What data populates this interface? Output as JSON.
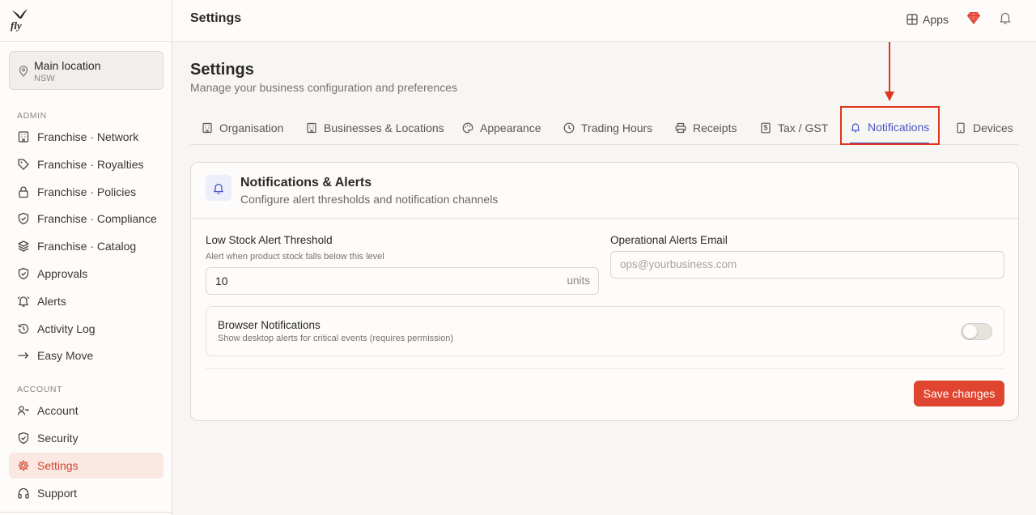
{
  "app": {
    "logo_text": "fly"
  },
  "sidebar": {
    "location": {
      "name": "Main location",
      "sub": "NSW"
    },
    "admin_label": "ADMIN",
    "admin_items": [
      {
        "label": "Franchise · Network",
        "icon": "building-icon"
      },
      {
        "label": "Franchise · Royalties",
        "icon": "tag-icon"
      },
      {
        "label": "Franchise · Policies",
        "icon": "lock-icon"
      },
      {
        "label": "Franchise · Compliance",
        "icon": "shield-check-icon"
      },
      {
        "label": "Franchise · Catalog",
        "icon": "layers-icon"
      },
      {
        "label": "Approvals",
        "icon": "shield-check-icon"
      },
      {
        "label": "Alerts",
        "icon": "bell-ring-icon"
      },
      {
        "label": "Activity Log",
        "icon": "history-icon"
      },
      {
        "label": "Easy Move",
        "icon": "arrow-right-icon"
      }
    ],
    "account_label": "ACCOUNT",
    "account_items": [
      {
        "label": "Account",
        "icon": "user-key-icon"
      },
      {
        "label": "Security",
        "icon": "shield-icon"
      },
      {
        "label": "Settings",
        "icon": "gear-icon",
        "active": true
      },
      {
        "label": "Support",
        "icon": "headphones-icon"
      }
    ]
  },
  "topbar": {
    "title": "Settings",
    "apps_label": "Apps"
  },
  "page": {
    "title": "Settings",
    "subtitle": "Manage your business configuration and preferences"
  },
  "tabs": [
    {
      "label": "Organisation",
      "icon": "building-icon"
    },
    {
      "label": "Businesses & Locations",
      "icon": "building-icon"
    },
    {
      "label": "Appearance",
      "icon": "palette-icon"
    },
    {
      "label": "Trading Hours",
      "icon": "clock-icon"
    },
    {
      "label": "Receipts",
      "icon": "printer-icon"
    },
    {
      "label": "Tax / GST",
      "icon": "dollar-receipt-icon"
    },
    {
      "label": "Notifications",
      "icon": "bell-icon",
      "active": true
    },
    {
      "label": "Devices",
      "icon": "tablet-icon"
    }
  ],
  "card": {
    "title": "Notifications & Alerts",
    "subtitle": "Configure alert thresholds and notification channels",
    "low_stock": {
      "label": "Low Stock Alert Threshold",
      "help": "Alert when product stock falls below this level",
      "value": "10",
      "suffix": "units"
    },
    "email": {
      "label": "Operational Alerts Email",
      "placeholder": "ops@yourbusiness.com",
      "value": ""
    },
    "browser": {
      "label": "Browser Notifications",
      "sub": "Show desktop alerts for critical events (requires permission)",
      "enabled": false
    },
    "save_label": "Save changes"
  },
  "colors": {
    "accent": "#e0452f",
    "tab_active": "#4a55c7",
    "annotation": "#e0341d"
  }
}
